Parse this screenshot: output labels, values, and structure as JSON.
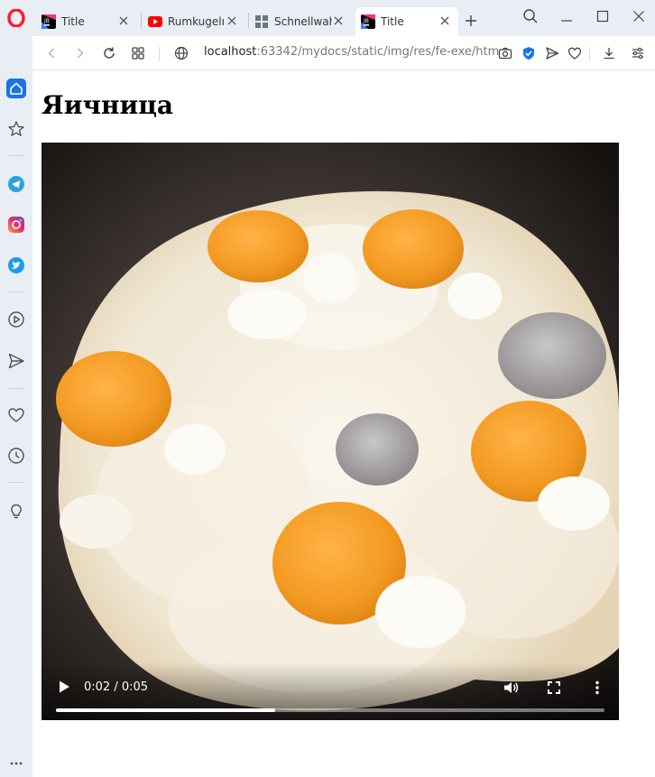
{
  "tabs": [
    {
      "title": "Title",
      "icon": "jetbrains-icon"
    },
    {
      "title": "Rumkugeln",
      "icon": "youtube-icon"
    },
    {
      "title": "Schnellwahl",
      "icon": "grid-icon"
    },
    {
      "title": "Title",
      "icon": "jetbrains-icon",
      "active": true
    }
  ],
  "address": {
    "host": "localhost",
    "rest": ":63342/mydocs/static/img/res/fe-exe/htm"
  },
  "page": {
    "heading": "Яичница"
  },
  "video": {
    "time": "0:02 / 0:05",
    "progress": 0.4
  },
  "colors": {
    "accent": "#1a73e8",
    "sidebar": "#e9eef5",
    "opera": "#ff1b2d"
  }
}
